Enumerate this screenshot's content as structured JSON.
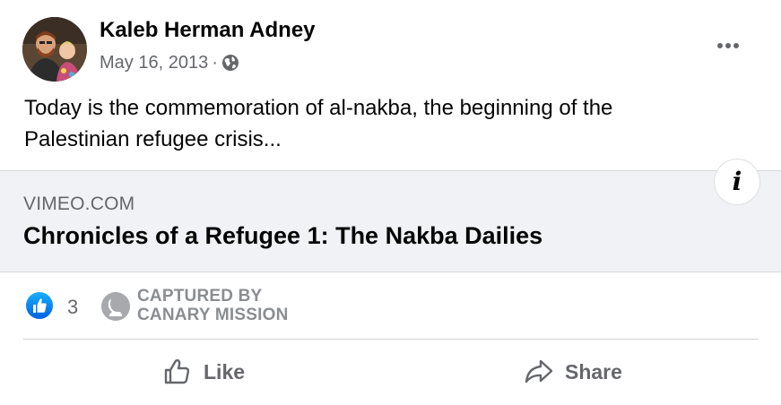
{
  "post": {
    "author_name": "Kaleb Herman Adney",
    "date": "May 16, 2013",
    "separator": "·",
    "privacy_icon": "globe-icon",
    "menu_icon": "more-horizontal-icon",
    "text_line1": "Today is the commemoration of al-nakba, the beginning of the",
    "text_line2": "Palestinian refugee crisis..."
  },
  "link_preview": {
    "domain": "VIMEO.COM",
    "title": "Chronicles of a Refugee 1: The Nakba Dailies",
    "info_icon": "info-icon",
    "info_glyph": "i"
  },
  "reactions": {
    "icon": "like-reaction-icon",
    "count": "3"
  },
  "watermark": {
    "icon": "canary-mission-logo",
    "line1": "CAPTURED BY",
    "line2": "CANARY MISSION"
  },
  "actions": {
    "like_label": "Like",
    "like_icon": "thumbs-up-icon",
    "share_label": "Share",
    "share_icon": "share-arrow-icon"
  },
  "colors": {
    "primary_text": "#050505",
    "secondary_text": "#65676b",
    "preview_bg": "#f0f2f5",
    "like_blue": "#1877f2",
    "watermark_gray": "#8a8d91"
  }
}
